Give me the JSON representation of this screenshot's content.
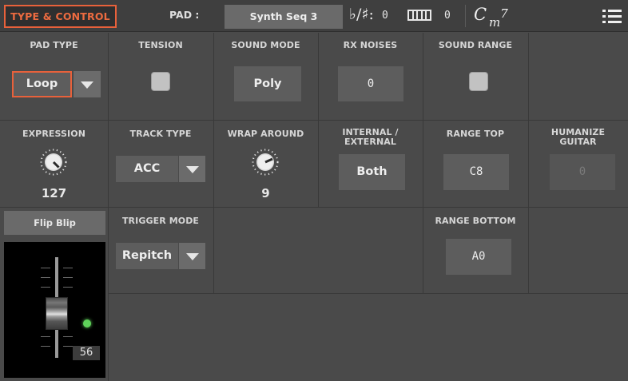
{
  "header": {
    "page_tab": "TYPE & CONTROL",
    "pad_label": "PAD :",
    "pad_name": "Synth Seq 3",
    "flat_sharp_symbol": "♭/♯:",
    "transpose_value": "0",
    "keyboard_icon": "keyboard-icon",
    "octave_value": "0",
    "chord_root": "C",
    "chord_type": "m7",
    "menu_icon": "menu-icon"
  },
  "row1": {
    "pad_type": {
      "title": "PAD TYPE",
      "value": "Loop"
    },
    "tension": {
      "title": "TENSION",
      "checked": false
    },
    "sound_mode": {
      "title": "SOUND MODE",
      "value": "Poly"
    },
    "rx_noises": {
      "title": "RX NOISES",
      "value": "0"
    },
    "sound_range": {
      "title": "SOUND RANGE",
      "checked": false
    }
  },
  "row2": {
    "expression": {
      "title": "EXPRESSION",
      "value": "127"
    },
    "track_type": {
      "title": "TRACK TYPE",
      "value": "ACC"
    },
    "wrap_around": {
      "title": "WRAP AROUND",
      "value": "9"
    },
    "internal_external": {
      "title_line1": "INTERNAL /",
      "title_line2": "EXTERNAL",
      "value": "Both"
    },
    "range_top": {
      "title": "RANGE TOP",
      "value": "C8"
    },
    "humanize_guitar": {
      "title_line1": "HUMANIZE",
      "title_line2": "GUITAR",
      "value": "0",
      "enabled": false
    }
  },
  "row3": {
    "trigger_mode": {
      "title": "TRIGGER MODE",
      "value": "Repitch"
    },
    "range_bottom": {
      "title": "RANGE BOTTOM",
      "value": "A0"
    }
  },
  "mixer": {
    "tab_label": "Flip Blip",
    "fader_value": "56",
    "led_color": "#5fd35a"
  },
  "colors": {
    "accent": "#e8613b",
    "background": "#4a4a4a",
    "control_fill": "#5d5d5d"
  }
}
